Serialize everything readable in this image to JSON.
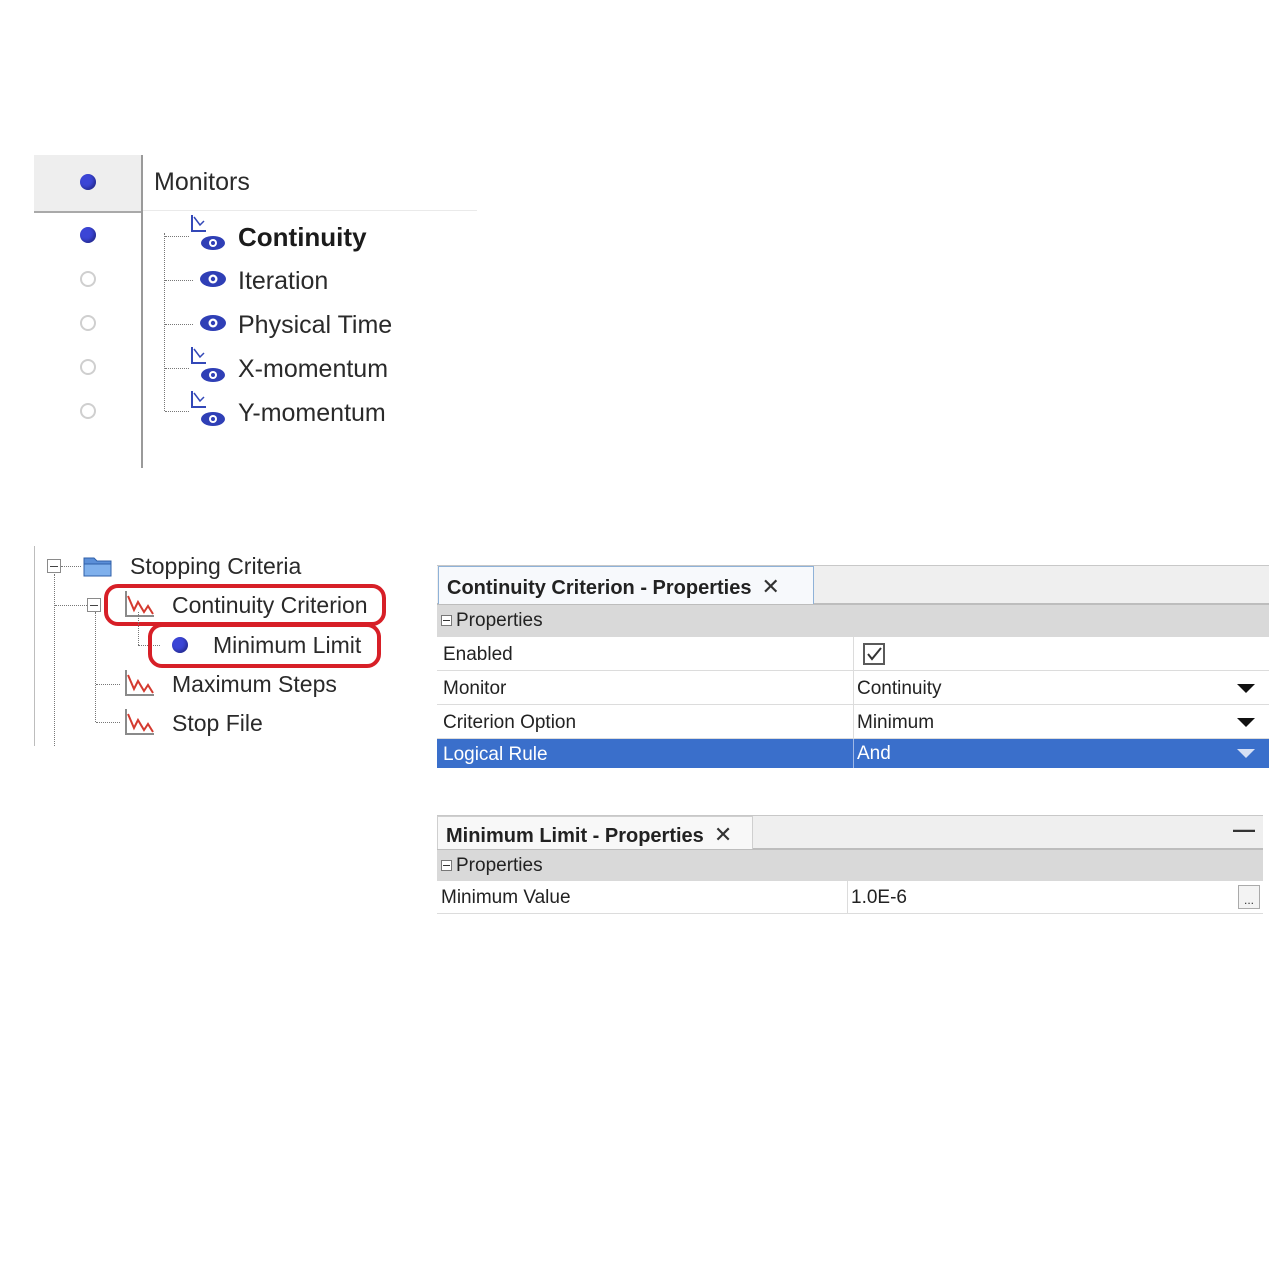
{
  "monitors": {
    "title": "Monitors",
    "items": [
      {
        "label": "Continuity",
        "selected": true,
        "has_plot": true
      },
      {
        "label": "Iteration",
        "selected": false,
        "has_plot": false
      },
      {
        "label": "Physical Time",
        "selected": false,
        "has_plot": false
      },
      {
        "label": "X-momentum",
        "selected": false,
        "has_plot": true
      },
      {
        "label": "Y-momentum",
        "selected": false,
        "has_plot": true
      }
    ]
  },
  "stopping_tree": {
    "root": "Stopping Criteria",
    "items": [
      {
        "label": "Continuity Criterion",
        "highlighted": true
      },
      {
        "label": "Minimum Limit",
        "highlighted": true
      },
      {
        "label": "Maximum Steps",
        "highlighted": false
      },
      {
        "label": "Stop File",
        "highlighted": false
      }
    ]
  },
  "continuity_panel": {
    "tab_title": "Continuity Criterion - Properties",
    "close_glyph": "✕",
    "section": "Properties",
    "rows": [
      {
        "name": "Enabled",
        "value": "",
        "checked": true
      },
      {
        "name": "Monitor",
        "value": "Continuity"
      },
      {
        "name": "Criterion Option",
        "value": "Minimum"
      },
      {
        "name": "Logical Rule",
        "value": "And",
        "selected": true
      }
    ]
  },
  "minimum_panel": {
    "tab_title": "Minimum Limit - Properties",
    "close_glyph": "✕",
    "minimize_glyph": "—",
    "section": "Properties",
    "rows": [
      {
        "name": "Minimum Value",
        "value": "1.0E-6",
        "button": "..."
      }
    ]
  },
  "colors": {
    "accent_dot": "#3b45d6",
    "selection": "#3a6fcb",
    "highlight_outline": "#d71f27"
  }
}
